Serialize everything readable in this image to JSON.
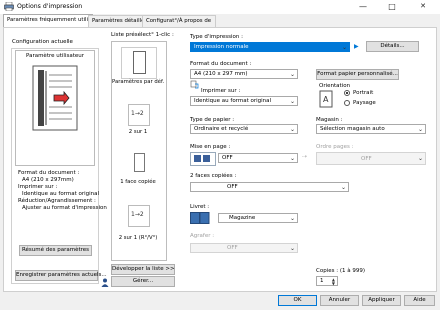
{
  "window": {
    "title": "Options d'impression",
    "controls": {
      "minimize": "—",
      "maximize": "□",
      "close": "✕"
    }
  },
  "tabs": [
    {
      "label": "Paramètres fréquemment utilisés",
      "active": true
    },
    {
      "label": "Paramètres détaillés",
      "active": false
    },
    {
      "label": "Configurat°/À propos de",
      "active": false
    }
  ],
  "left": {
    "config_title": "Configuration actuelle",
    "user_settings": "Paramètre utilisateur",
    "summary_lines": [
      "Format du document :",
      "A4 (210 x 297mm)",
      "Imprimer sur :",
      "Identique au format original",
      "Réduction/Agrandissement :",
      "Ajuster au format d'impression"
    ],
    "summary_button": "Résumé des paramètres",
    "save_button": "Enregistrer paramètres actuels..."
  },
  "favorites": {
    "title": "Liste présélect° 1-clic :",
    "items": [
      {
        "label": "Paramètres par déf.",
        "icon": "default-settings-icon"
      },
      {
        "label": "2 sur 1",
        "icon": "two-up-icon",
        "glyph": "1→2"
      },
      {
        "label": "1 face copiée",
        "icon": "one-sided-icon"
      },
      {
        "label": "2 sur 1 (R°/V°)",
        "icon": "two-up-duplex-icon",
        "glyph": "1→2"
      }
    ],
    "expand_button": "Développer la liste >>",
    "manage_button": "Gérer..."
  },
  "settings": {
    "print_type_label": "Type d'impression :",
    "print_type_value": "Impression normale",
    "details_button": "Détails...",
    "doc_size_label": "Format du document :",
    "doc_size_value": "A4 (210 x 297 mm)",
    "custom_paper_button": "Format papier personnalisé...",
    "print_on_label": "Imprimer sur :",
    "print_on_value": "Identique au format original",
    "orientation_label": "Orientation",
    "orientation_options": [
      "Portrait",
      "Paysage"
    ],
    "orientation_selected": "Portrait",
    "paper_type_label": "Type de papier :",
    "paper_type_value": "Ordinaire et recyclé",
    "tray_label": "Magasin :",
    "tray_value": "Sélection magasin auto",
    "layout_label": "Mise en page :",
    "layout_value": "OFF",
    "page_order_label": "Ordre pages :",
    "page_order_value": "OFF",
    "duplex_label": "2 faces copiées :",
    "duplex_value": "OFF",
    "booklet_label": "Livret :",
    "booklet_value": "Magazine",
    "staple_label": "Agrafer :",
    "staple_value": "OFF",
    "copies_label": "Copies : (1 à 999)",
    "copies_value": "1"
  },
  "footer": {
    "ok": "OK",
    "cancel": "Annuler",
    "apply": "Appliquer",
    "help": "Aide"
  }
}
